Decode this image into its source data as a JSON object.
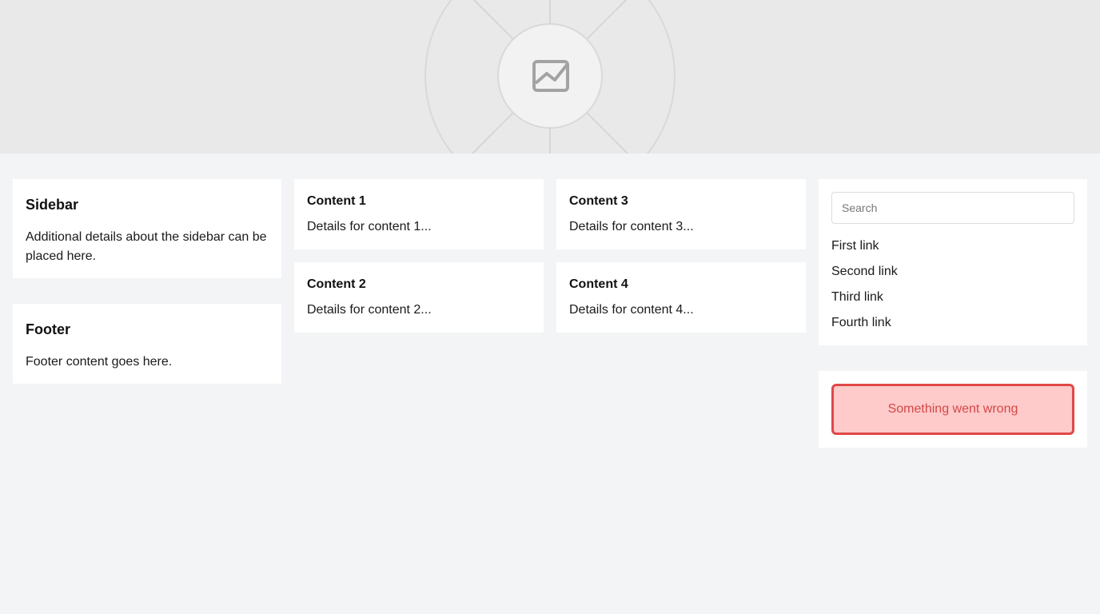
{
  "hero": {
    "icon": "image-placeholder-icon"
  },
  "sidebar": {
    "title": "Sidebar",
    "text": "Additional details about the sidebar can be placed here."
  },
  "footer": {
    "title": "Footer",
    "text": "Footer content goes here."
  },
  "contents": [
    {
      "title": "Content 1",
      "text": "Details for content 1..."
    },
    {
      "title": "Content 2",
      "text": "Details for content 2..."
    },
    {
      "title": "Content 3",
      "text": "Details for content 3..."
    },
    {
      "title": "Content 4",
      "text": "Details for content 4..."
    }
  ],
  "search": {
    "placeholder": "Search",
    "value": ""
  },
  "links": [
    "First link",
    "Second link",
    "Third link",
    "Fourth link"
  ],
  "error": {
    "message": "Something went wrong"
  },
  "colors": {
    "background": "#f3f4f6",
    "hero": "#e9e9e9",
    "error_bg": "#fecaca",
    "error_border": "#e04848",
    "error_text": "#d44848"
  }
}
